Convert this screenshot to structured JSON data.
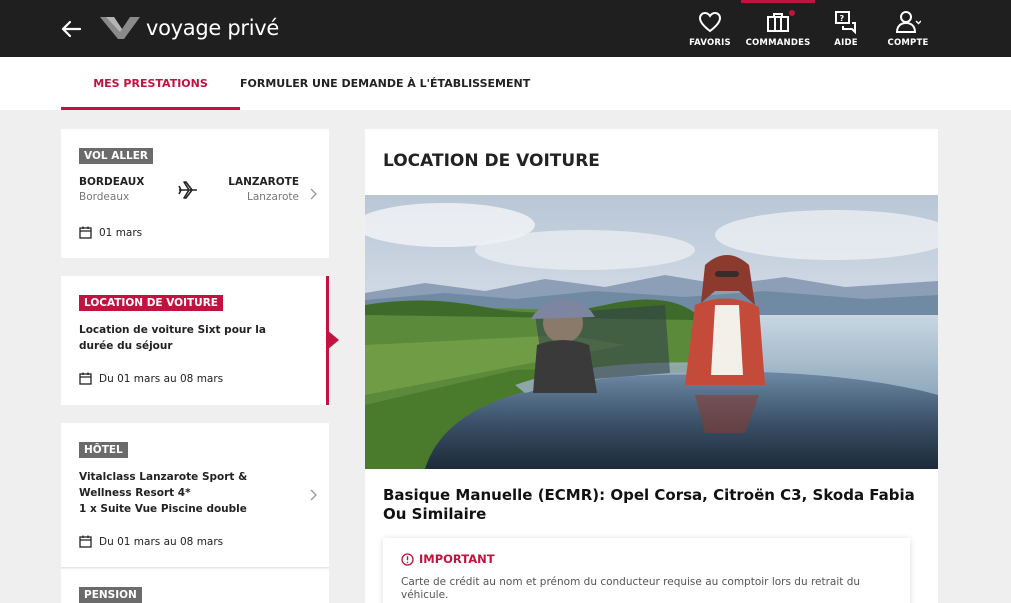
{
  "header": {
    "brand_main": "voyage",
    "brand_accent": " privé",
    "nav": [
      {
        "label": "FAVORIS",
        "icon": "heart-icon"
      },
      {
        "label": "COMMANDES",
        "icon": "briefcase-icon"
      },
      {
        "label": "AIDE",
        "icon": "chat-help-icon"
      },
      {
        "label": "COMPTE",
        "icon": "user-icon"
      }
    ]
  },
  "tabs": {
    "prestations": "MES PRESTATIONS",
    "demande": "FORMULER UNE DEMANDE À L'ÉTABLISSEMENT"
  },
  "cards": {
    "flight": {
      "badge": "VOL ALLER",
      "from_code": "BORDEAUX",
      "from_city": "Bordeaux",
      "to_code": "LANZAROTE",
      "to_city": "Lanzarote",
      "date": "01 mars"
    },
    "car": {
      "badge": "LOCATION DE VOITURE",
      "description": "Location de voiture Sixt pour la durée du séjour",
      "date": "Du 01 mars au 08 mars"
    },
    "hotel": {
      "badge": "HÔTEL",
      "line1": "Vitalclass Lanzarote Sport & Wellness Resort 4*",
      "line2": "1 x Suite Vue Piscine double",
      "date": "Du 01 mars au 08 mars"
    },
    "pension": {
      "badge": "PENSION"
    }
  },
  "panel": {
    "title": "LOCATION DE VOITURE",
    "car_name": "Basique Manuelle (ECMR): Opel Corsa, Citroën C3, Skoda Fabia Ou Similaire",
    "notice_title": "IMPORTANT",
    "notice_text": "Carte de crédit au nom et prénom du conducteur requise au comptoir lors du retrait du véhicule."
  },
  "colors": {
    "accent": "#c2123f",
    "topbar": "#1f1f1f",
    "badge_grey": "#6b6b6b",
    "background": "#efefef"
  }
}
